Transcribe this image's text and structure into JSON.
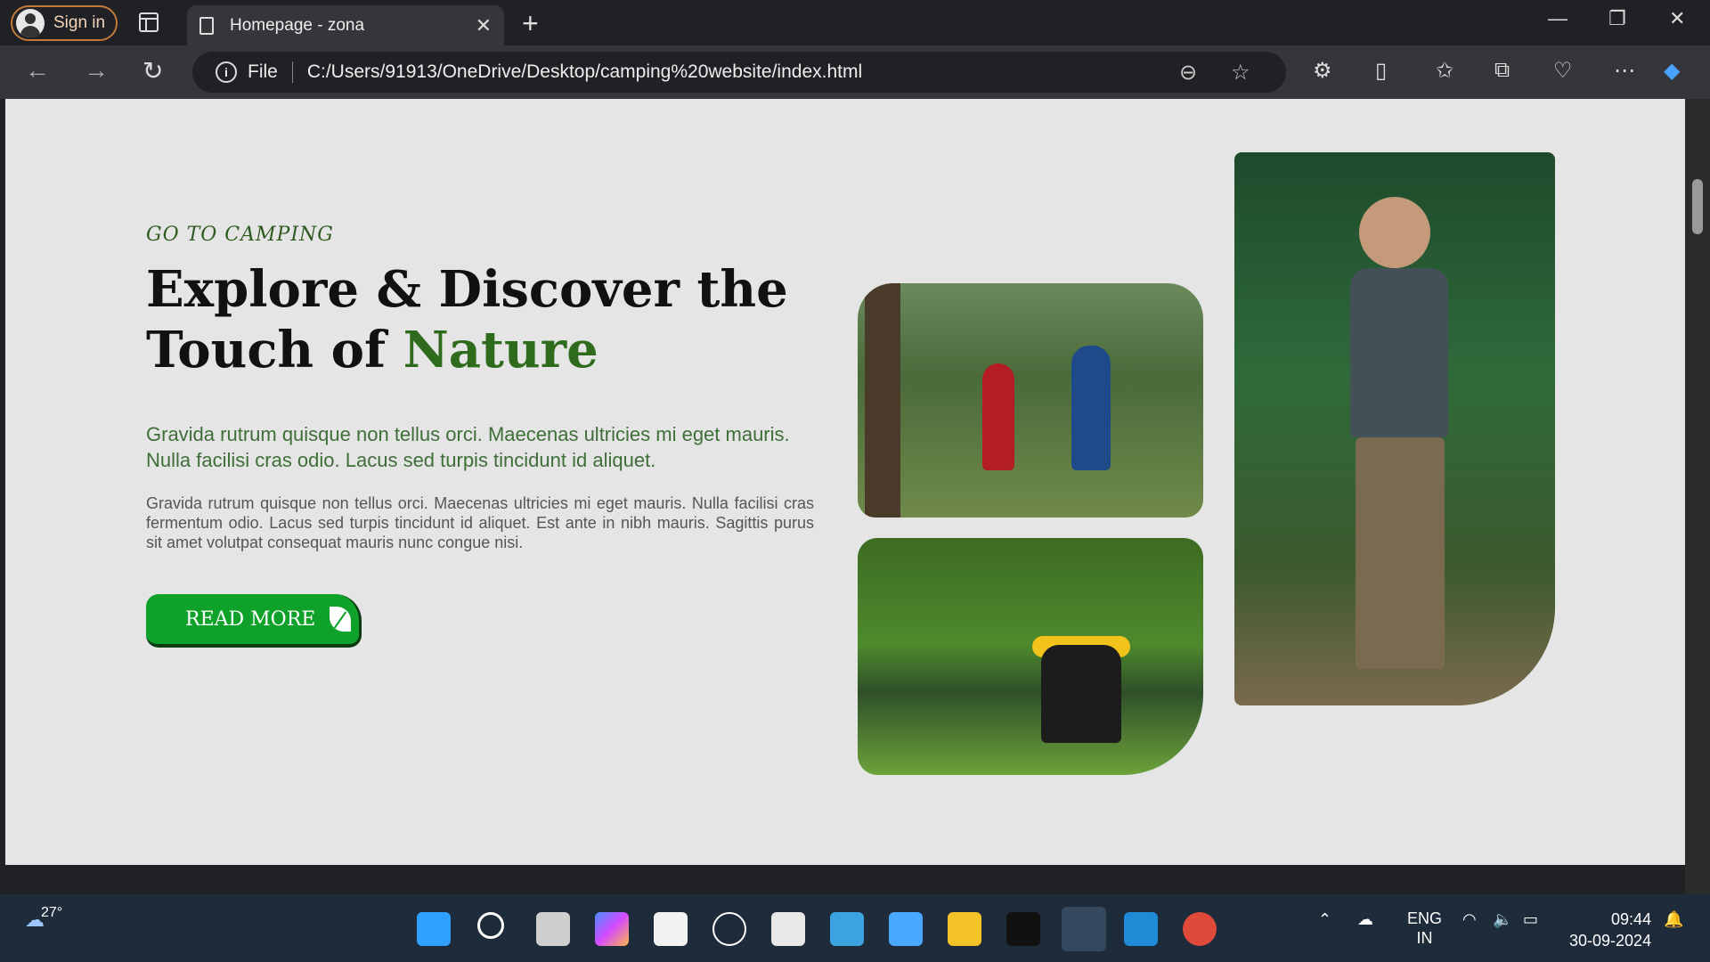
{
  "browser": {
    "signin_label": "Sign in",
    "tab_title": "Homepage - zona",
    "address_scheme": "File",
    "address_url": "C:/Users/91913/OneDrive/Desktop/camping%20website/index.html"
  },
  "hero": {
    "kicker": "GO TO CAMPING",
    "headline_part1": "Explore & Discover the",
    "headline_part2": "Touch of",
    "headline_highlight": "Nature",
    "lead": "Gravida rutrum quisque non tellus orci. Maecenas ultricies mi eget mauris. Nulla facilisi cras odio. Lacus sed turpis tincidunt id aliquet.",
    "body": "Gravida rutrum quisque non tellus orci. Maecenas ultricies mi eget mauris. Nulla facilisi cras fermentum odio. Lacus sed turpis tincidunt id aliquet. Est ante in nibh mauris. Sagittis purus sit amet volutpat consequat mauris nunc congue nisi.",
    "cta_label": "READ MORE"
  },
  "taskbar": {
    "temperature": "27°",
    "lang_line1": "ENG",
    "lang_line2": "IN",
    "time": "09:44",
    "date": "30-09-2024"
  },
  "colors": {
    "accent_green": "#2f6b1c",
    "button_green": "#0ea22a",
    "page_bg": "#e5e5e5"
  }
}
